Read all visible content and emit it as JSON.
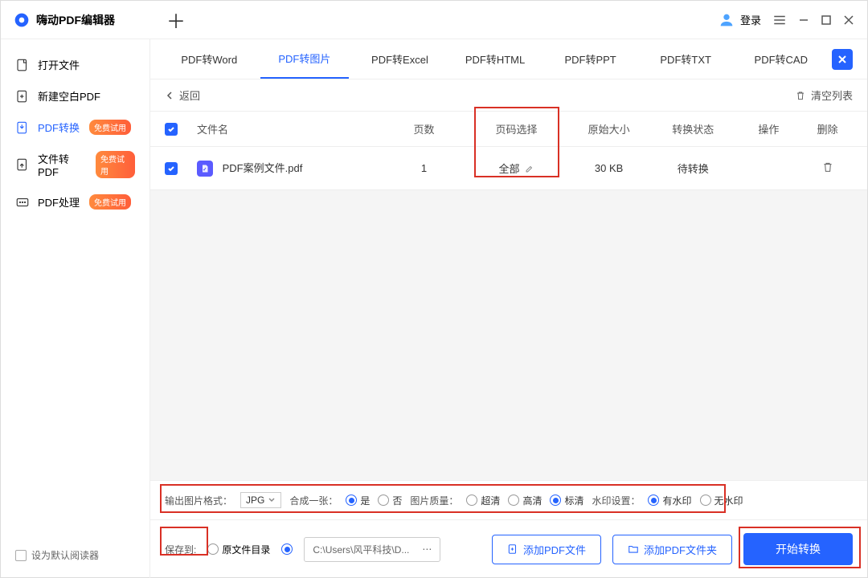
{
  "app": {
    "title": "嗨动PDF编辑器"
  },
  "titlebar": {
    "login": "登录"
  },
  "sidebar": {
    "items": [
      {
        "label": "打开文件"
      },
      {
        "label": "新建空白PDF"
      },
      {
        "label": "PDF转换",
        "badge": "免费试用"
      },
      {
        "label": "文件转PDF",
        "badge": "免费试用"
      },
      {
        "label": "PDF处理",
        "badge": "免费试用"
      }
    ],
    "default_reader": "设为默认阅读器"
  },
  "tabs": {
    "items": [
      "PDF转Word",
      "PDF转图片",
      "PDF转Excel",
      "PDF转HTML",
      "PDF转PPT",
      "PDF转TXT",
      "PDF转CAD"
    ],
    "active": 1
  },
  "toolbar": {
    "back": "返回",
    "clear": "清空列表"
  },
  "table": {
    "headers": {
      "name": "文件名",
      "pages": "页数",
      "range": "页码选择",
      "size": "原始大小",
      "status": "转换状态",
      "op": "操作",
      "del": "删除"
    },
    "rows": [
      {
        "name": "PDF案例文件.pdf",
        "pages": "1",
        "range": "全部",
        "size": "30 KB",
        "status": "待转换"
      }
    ]
  },
  "options": {
    "format_label": "输出图片格式：",
    "format_value": "JPG",
    "merge_label": "合成一张：",
    "merge_yes": "是",
    "merge_no": "否",
    "quality_label": "图片质量：",
    "q_ultra": "超清",
    "q_high": "高清",
    "q_std": "标清",
    "watermark_label": "水印设置：",
    "wm_yes": "有水印",
    "wm_no": "无水印"
  },
  "bottom": {
    "save_label": "保存到:",
    "orig_dir": "原文件目录",
    "path": "C:\\Users\\风平科技\\D...",
    "add_file": "添加PDF文件",
    "add_folder": "添加PDF文件夹",
    "start": "开始转换"
  }
}
